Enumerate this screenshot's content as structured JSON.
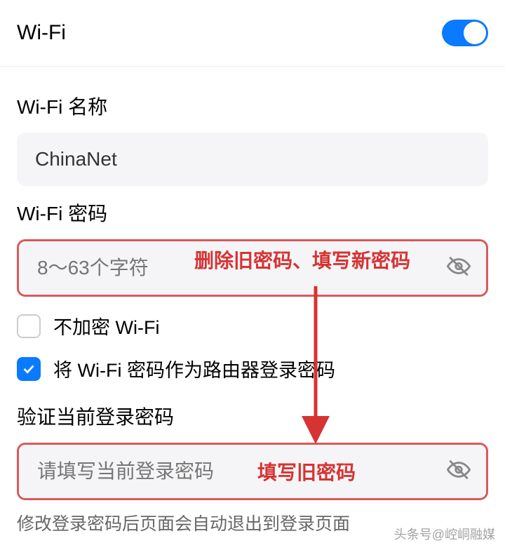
{
  "header": {
    "title": "Wi-Fi",
    "toggle_on": true
  },
  "wifi_name": {
    "label": "Wi-Fi 名称",
    "value": "ChinaNet"
  },
  "wifi_password": {
    "label": "Wi-Fi 密码",
    "placeholder": "8～63个字符",
    "annotation": "删除旧密码、填写新密码"
  },
  "options": {
    "no_encryption": {
      "label": "不加密 Wi-Fi",
      "checked": false
    },
    "use_as_router_login": {
      "label": "将 Wi-Fi 密码作为路由器登录密码",
      "checked": true
    }
  },
  "verify_login": {
    "label": "验证当前登录密码",
    "placeholder": "请填写当前登录密码",
    "annotation": "填写旧密码"
  },
  "helper": {
    "text": "修改登录密码后页面会自动退出到登录页面"
  },
  "watermark": "头条号@崆峒融媒",
  "colors": {
    "accent": "#0a7aff",
    "annotation": "#d63333",
    "highlight_border": "#d85a5a"
  }
}
